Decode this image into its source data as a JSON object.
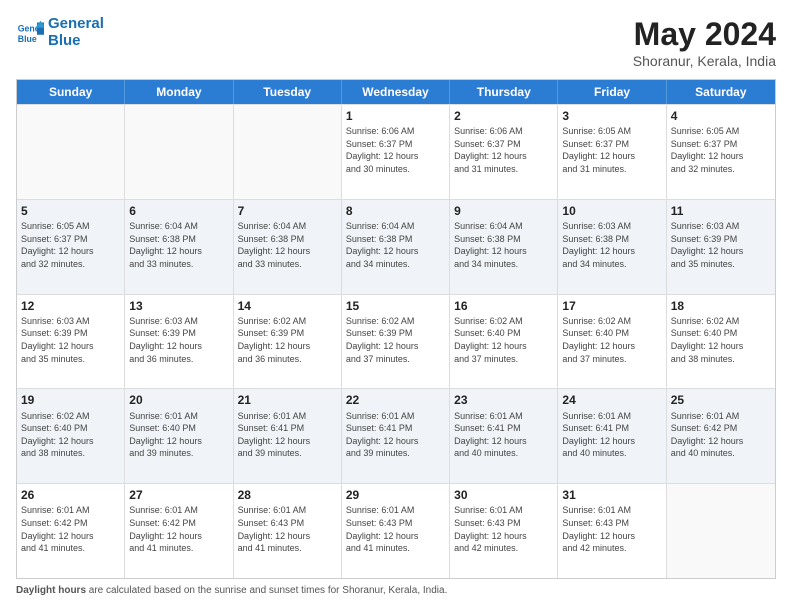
{
  "header": {
    "logo_line1": "General",
    "logo_line2": "Blue",
    "month_year": "May 2024",
    "location": "Shoranur, Kerala, India"
  },
  "day_headers": [
    "Sunday",
    "Monday",
    "Tuesday",
    "Wednesday",
    "Thursday",
    "Friday",
    "Saturday"
  ],
  "weeks": [
    [
      {
        "day": "",
        "info": ""
      },
      {
        "day": "",
        "info": ""
      },
      {
        "day": "",
        "info": ""
      },
      {
        "day": "1",
        "info": "Sunrise: 6:06 AM\nSunset: 6:37 PM\nDaylight: 12 hours\nand 30 minutes."
      },
      {
        "day": "2",
        "info": "Sunrise: 6:06 AM\nSunset: 6:37 PM\nDaylight: 12 hours\nand 31 minutes."
      },
      {
        "day": "3",
        "info": "Sunrise: 6:05 AM\nSunset: 6:37 PM\nDaylight: 12 hours\nand 31 minutes."
      },
      {
        "day": "4",
        "info": "Sunrise: 6:05 AM\nSunset: 6:37 PM\nDaylight: 12 hours\nand 32 minutes."
      }
    ],
    [
      {
        "day": "5",
        "info": "Sunrise: 6:05 AM\nSunset: 6:37 PM\nDaylight: 12 hours\nand 32 minutes."
      },
      {
        "day": "6",
        "info": "Sunrise: 6:04 AM\nSunset: 6:38 PM\nDaylight: 12 hours\nand 33 minutes."
      },
      {
        "day": "7",
        "info": "Sunrise: 6:04 AM\nSunset: 6:38 PM\nDaylight: 12 hours\nand 33 minutes."
      },
      {
        "day": "8",
        "info": "Sunrise: 6:04 AM\nSunset: 6:38 PM\nDaylight: 12 hours\nand 34 minutes."
      },
      {
        "day": "9",
        "info": "Sunrise: 6:04 AM\nSunset: 6:38 PM\nDaylight: 12 hours\nand 34 minutes."
      },
      {
        "day": "10",
        "info": "Sunrise: 6:03 AM\nSunset: 6:38 PM\nDaylight: 12 hours\nand 34 minutes."
      },
      {
        "day": "11",
        "info": "Sunrise: 6:03 AM\nSunset: 6:39 PM\nDaylight: 12 hours\nand 35 minutes."
      }
    ],
    [
      {
        "day": "12",
        "info": "Sunrise: 6:03 AM\nSunset: 6:39 PM\nDaylight: 12 hours\nand 35 minutes."
      },
      {
        "day": "13",
        "info": "Sunrise: 6:03 AM\nSunset: 6:39 PM\nDaylight: 12 hours\nand 36 minutes."
      },
      {
        "day": "14",
        "info": "Sunrise: 6:02 AM\nSunset: 6:39 PM\nDaylight: 12 hours\nand 36 minutes."
      },
      {
        "day": "15",
        "info": "Sunrise: 6:02 AM\nSunset: 6:39 PM\nDaylight: 12 hours\nand 37 minutes."
      },
      {
        "day": "16",
        "info": "Sunrise: 6:02 AM\nSunset: 6:40 PM\nDaylight: 12 hours\nand 37 minutes."
      },
      {
        "day": "17",
        "info": "Sunrise: 6:02 AM\nSunset: 6:40 PM\nDaylight: 12 hours\nand 37 minutes."
      },
      {
        "day": "18",
        "info": "Sunrise: 6:02 AM\nSunset: 6:40 PM\nDaylight: 12 hours\nand 38 minutes."
      }
    ],
    [
      {
        "day": "19",
        "info": "Sunrise: 6:02 AM\nSunset: 6:40 PM\nDaylight: 12 hours\nand 38 minutes."
      },
      {
        "day": "20",
        "info": "Sunrise: 6:01 AM\nSunset: 6:40 PM\nDaylight: 12 hours\nand 39 minutes."
      },
      {
        "day": "21",
        "info": "Sunrise: 6:01 AM\nSunset: 6:41 PM\nDaylight: 12 hours\nand 39 minutes."
      },
      {
        "day": "22",
        "info": "Sunrise: 6:01 AM\nSunset: 6:41 PM\nDaylight: 12 hours\nand 39 minutes."
      },
      {
        "day": "23",
        "info": "Sunrise: 6:01 AM\nSunset: 6:41 PM\nDaylight: 12 hours\nand 40 minutes."
      },
      {
        "day": "24",
        "info": "Sunrise: 6:01 AM\nSunset: 6:41 PM\nDaylight: 12 hours\nand 40 minutes."
      },
      {
        "day": "25",
        "info": "Sunrise: 6:01 AM\nSunset: 6:42 PM\nDaylight: 12 hours\nand 40 minutes."
      }
    ],
    [
      {
        "day": "26",
        "info": "Sunrise: 6:01 AM\nSunset: 6:42 PM\nDaylight: 12 hours\nand 41 minutes."
      },
      {
        "day": "27",
        "info": "Sunrise: 6:01 AM\nSunset: 6:42 PM\nDaylight: 12 hours\nand 41 minutes."
      },
      {
        "day": "28",
        "info": "Sunrise: 6:01 AM\nSunset: 6:43 PM\nDaylight: 12 hours\nand 41 minutes."
      },
      {
        "day": "29",
        "info": "Sunrise: 6:01 AM\nSunset: 6:43 PM\nDaylight: 12 hours\nand 41 minutes."
      },
      {
        "day": "30",
        "info": "Sunrise: 6:01 AM\nSunset: 6:43 PM\nDaylight: 12 hours\nand 42 minutes."
      },
      {
        "day": "31",
        "info": "Sunrise: 6:01 AM\nSunset: 6:43 PM\nDaylight: 12 hours\nand 42 minutes."
      },
      {
        "day": "",
        "info": ""
      }
    ]
  ],
  "footer": {
    "label": "Daylight hours",
    "text": " are calculated based on the sunrise and sunset times for Shoranur, Kerala, India."
  }
}
